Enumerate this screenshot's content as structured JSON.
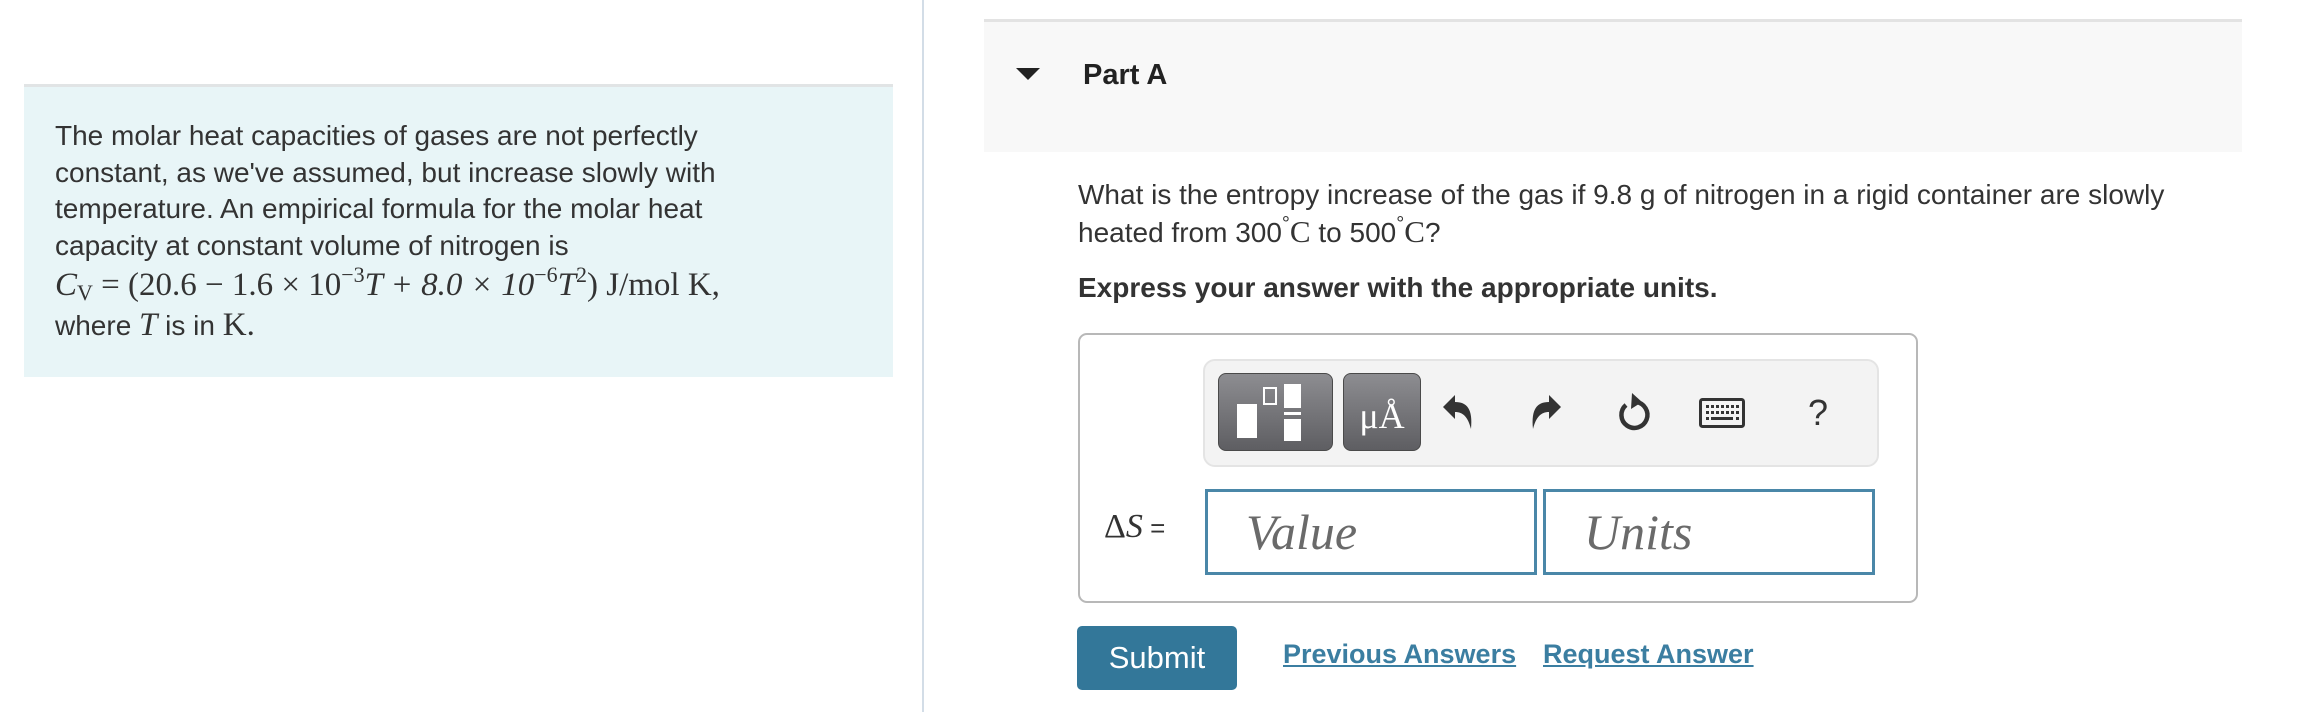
{
  "intro": {
    "text_lines": [
      "The molar heat capacities of gases are not perfectly",
      "constant, as we've assumed, but increase slowly with",
      "temperature. An empirical formula for the molar heat",
      "capacity at constant volume of nitrogen is"
    ],
    "formula": {
      "lhs_symbol": "C",
      "lhs_subscript": "V",
      "equals": " = (20.6 − 1.6 × 10",
      "exp1": "−3",
      "term1": "T + 8.0 × 10",
      "exp2": "−6",
      "term2": "T",
      "exp3": "2",
      "tail": ") J/mol K,"
    },
    "where_prefix": "where ",
    "where_var": "T",
    "where_mid": " is in ",
    "where_unit": "K."
  },
  "part": {
    "title": "Part A",
    "expanded": true
  },
  "question": {
    "line1": "What is the entropy increase of the gas if 9.8 g of nitrogen in a rigid container are slowly",
    "line2_prefix": "heated from 300",
    "deg": "°",
    "unit_c": "C",
    "mid": " to 500",
    "end": "?",
    "instruction": "Express your answer with the appropriate units."
  },
  "toolbar": {
    "templates_icon": "fraction-template-icon",
    "units_label": "μÅ",
    "undo_icon": "undo-icon",
    "redo_icon": "redo-icon",
    "reset_icon": "reset-icon",
    "keyboard_icon": "keyboard-icon",
    "help_label": "?"
  },
  "answer": {
    "label_delta": "Δ",
    "label_var": "S",
    "label_eq": " =",
    "value_placeholder": "Value",
    "value": "",
    "units_placeholder": "Units",
    "units": ""
  },
  "actions": {
    "submit_label": "Submit",
    "previous_answers_label": "Previous Answers",
    "request_answer_label": "Request Answer"
  },
  "colors": {
    "primary": "#337799",
    "link": "#3b7ea1",
    "intro_bg": "#e8f5f7",
    "header_bg": "#f8f8f8"
  }
}
